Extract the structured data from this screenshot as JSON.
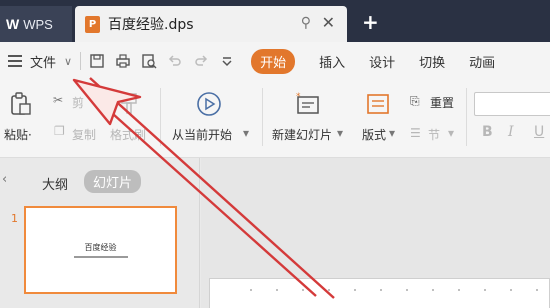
{
  "titlebar": {
    "app_tab": {
      "logo": "W",
      "label": "WPS"
    },
    "doc_tab": {
      "icon_letter": "P",
      "title": "百度经验.dps"
    },
    "new_tab_label": "+"
  },
  "menubar": {
    "file_label": "文件",
    "chevron": "∨",
    "tabs": [
      "开始",
      "插入",
      "设计",
      "切换",
      "动画"
    ]
  },
  "ribbon": {
    "paste": "粘贴",
    "paste_arrow": "·",
    "cut": "剪",
    "copy": "复制",
    "format_painter": "格式刷",
    "play_from_current": "从当前开始",
    "new_slide": "新建幻灯片",
    "layout": "版式",
    "reset": "重置",
    "section": "节",
    "bold": "B",
    "italic": "I",
    "underline": "U"
  },
  "left_panel": {
    "collapse": "‹",
    "tab_outline": "大纲",
    "tab_slides": "幻灯片",
    "slide_number": "1",
    "thumb_title": "百度经验"
  },
  "colors": {
    "accent": "#e2772c",
    "titlebar": "#2a3143",
    "arrow": "#d43a3a"
  }
}
